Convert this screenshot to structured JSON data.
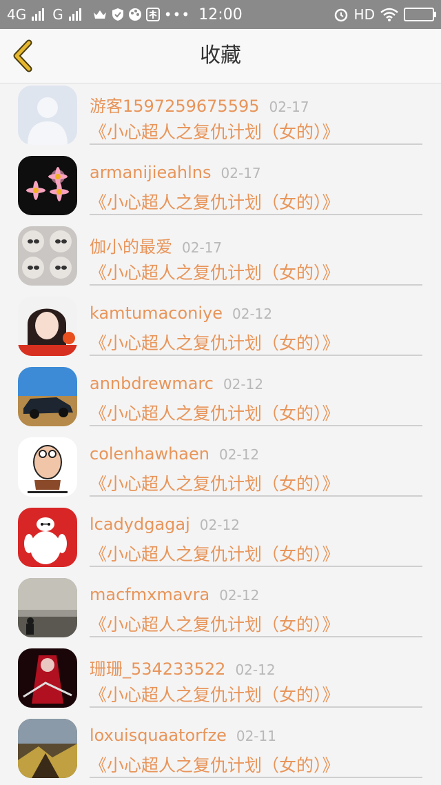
{
  "status_bar": {
    "network_left": "4G",
    "network_right": "G",
    "time": "12:00",
    "hd": "HD"
  },
  "nav": {
    "title": "收藏"
  },
  "items": [
    {
      "username": "游客1597259675595",
      "date": "02-17",
      "title": "《小心超人之复仇计划（女的）》"
    },
    {
      "username": "armanijieahlns",
      "date": "02-17",
      "title": "《小心超人之复仇计划（女的）》"
    },
    {
      "username": "伽小的最爱",
      "date": "02-17",
      "title": "《小心超人之复仇计划（女的）》"
    },
    {
      "username": "kamtumaconiye",
      "date": "02-12",
      "title": "《小心超人之复仇计划（女的）》"
    },
    {
      "username": "annbdrewmarc",
      "date": "02-12",
      "title": "《小心超人之复仇计划（女的）》"
    },
    {
      "username": "colenhawhaen",
      "date": "02-12",
      "title": "《小心超人之复仇计划（女的）》"
    },
    {
      "username": "lcadydgagaj",
      "date": "02-12",
      "title": "《小心超人之复仇计划（女的）》"
    },
    {
      "username": "macfmxmavra",
      "date": "02-12",
      "title": "《小心超人之复仇计划（女的）》"
    },
    {
      "username": "珊珊_534233522",
      "date": "02-12",
      "title": "《小心超人之复仇计划（女的）》"
    },
    {
      "username": "loxuisquaatorfze",
      "date": "02-11",
      "title": "《小心超人之复仇计划（女的）》"
    }
  ],
  "colors": {
    "accent": "#e8955a",
    "back_arrow": "#e6b830",
    "date": "#b8b8b8"
  }
}
